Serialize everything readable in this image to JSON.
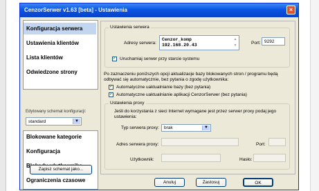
{
  "window": {
    "title": "CenzorSerwer v1.63 [beta] - Ustawienia",
    "close_glyph": "×"
  },
  "sidebar": {
    "group1": [
      {
        "label": "Konfiguracja serwera",
        "active": true
      },
      {
        "label": "Ustawienia klientów"
      },
      {
        "label": "Lista klientów"
      },
      {
        "label": "Odwiedzone strony"
      }
    ],
    "schema_label": "Edytowany schemat konfiguracji:",
    "schema_value": "standard",
    "group2": [
      {
        "label": "Blokowane kategorie"
      },
      {
        "label": "Konfiguracja"
      },
      {
        "label": "Blokady użytkownika"
      },
      {
        "label": "Ograniczenia czasowe"
      }
    ],
    "save_schema_label": "Zapisz schemat jako..."
  },
  "server": {
    "legend": "Ustawienia serwera",
    "address_label": "Adresy serwera:",
    "address_lines": [
      "Cenzor_komp",
      "192.168.20.43"
    ],
    "port_label": "Port:",
    "port_value": "9292",
    "autostart_label": "Uruchamiaj serwer przy starcie systemu",
    "autostart_checked": true
  },
  "update": {
    "description": "Po zaznaczeniu poniższych opcji aktualizacje bazy blokowanych stron / programu będą odbywać się automatycznie, bez pytania o zgodę użytkownika:",
    "auto_db_label": "Automatyczne uaktualnianie bazy (bez pytania)",
    "auto_db_checked": true,
    "auto_app_label": "Automatyczne uaktualnianie aplikacji CenzorSerwer (bez pytania)",
    "auto_app_checked": true
  },
  "proxy": {
    "legend": "Ustawienia proxy",
    "description": "Jeśli do korzystania z sieci Internet wymagane jest przez serwer proxy podaj jego ustawienia:",
    "type_label": "Typ serwera proxy:",
    "type_value": "brak",
    "address_label": "Adres serwera proxy:",
    "address_value": "",
    "port_label": "Port:",
    "port_value": "",
    "user_label": "Użytkownik:",
    "user_value": "",
    "password_label": "Hasło:",
    "password_value": ""
  },
  "footer": {
    "cancel_label": "Anuluj",
    "apply_label": "Zastosuj",
    "ok_label": "OK"
  },
  "icons": {
    "checkmark": "✓",
    "dropdown": "▼",
    "scroll_up": "▲",
    "scroll_down": "▼"
  },
  "colors": {
    "titlebar": "#0a54e3",
    "window_bg": "#ece9d8",
    "nav_active": "#c3d6ef",
    "close_button": "#e0502c"
  }
}
